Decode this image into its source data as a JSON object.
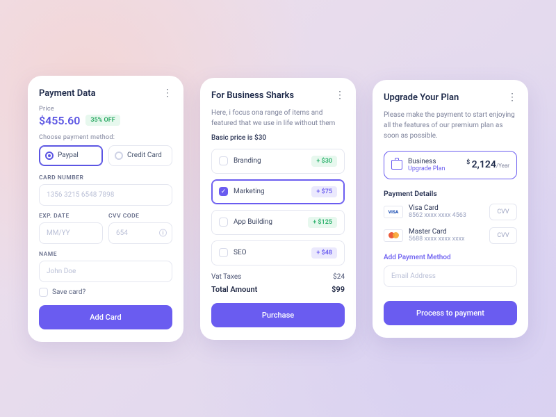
{
  "card1": {
    "title": "Payment Data",
    "priceLabel": "Price",
    "price": "$455.60",
    "discount": "35% OFF",
    "methodLabel": "Choose payment method:",
    "methods": {
      "paypal": "Paypal",
      "credit": "Credit Card"
    },
    "cardNumberLabel": "CARD NUMBER",
    "cardNumberPH": "1356 3215 6548 7898",
    "expLabel": "EXP. DATE",
    "expPH": "MM/YY",
    "cvvLabel": "CVV CODE",
    "cvvPH": "654",
    "nameLabel": "NAME",
    "namePH": "John Doe",
    "save": "Save card?",
    "button": "Add Card"
  },
  "card2": {
    "title": "For Business Sharks",
    "desc": "Here, i focus ona range of items and featured that we use in life without them",
    "base": "Basic price is $30",
    "options": [
      {
        "label": "Branding",
        "price": "+ $30",
        "cls": "op-green",
        "sel": false
      },
      {
        "label": "Marketing",
        "price": "+ $75",
        "cls": "op-purple",
        "sel": true
      },
      {
        "label": "App Building",
        "price": "+ $125",
        "cls": "op-green",
        "sel": false
      },
      {
        "label": "SEO",
        "price": "+ $48",
        "cls": "op-purple",
        "sel": false
      }
    ],
    "vatLabel": "Vat Taxes",
    "vat": "$24",
    "totalLabel": "Total Amount",
    "total": "$99",
    "button": "Purchase"
  },
  "card3": {
    "title": "Upgrade Your Plan",
    "desc": "Please make the payment to start enjoying all the features of our premium plan as soon as possible.",
    "planName": "Business",
    "planLink": "Upgrade Plan",
    "planPrice": "2,124",
    "planUnit": "/Year",
    "detailsTitle": "Payment Details",
    "cards": [
      {
        "type": "visa",
        "name": "Visa Card",
        "num": "8562 xxxx xxxx 4563"
      },
      {
        "type": "mc",
        "name": "Master Card",
        "num": "5688 xxxx xxxx xxxx"
      }
    ],
    "cvv": "CVV",
    "addPay": "Add Payment Method",
    "emailPH": "Email Address",
    "button": "Process to payment"
  }
}
